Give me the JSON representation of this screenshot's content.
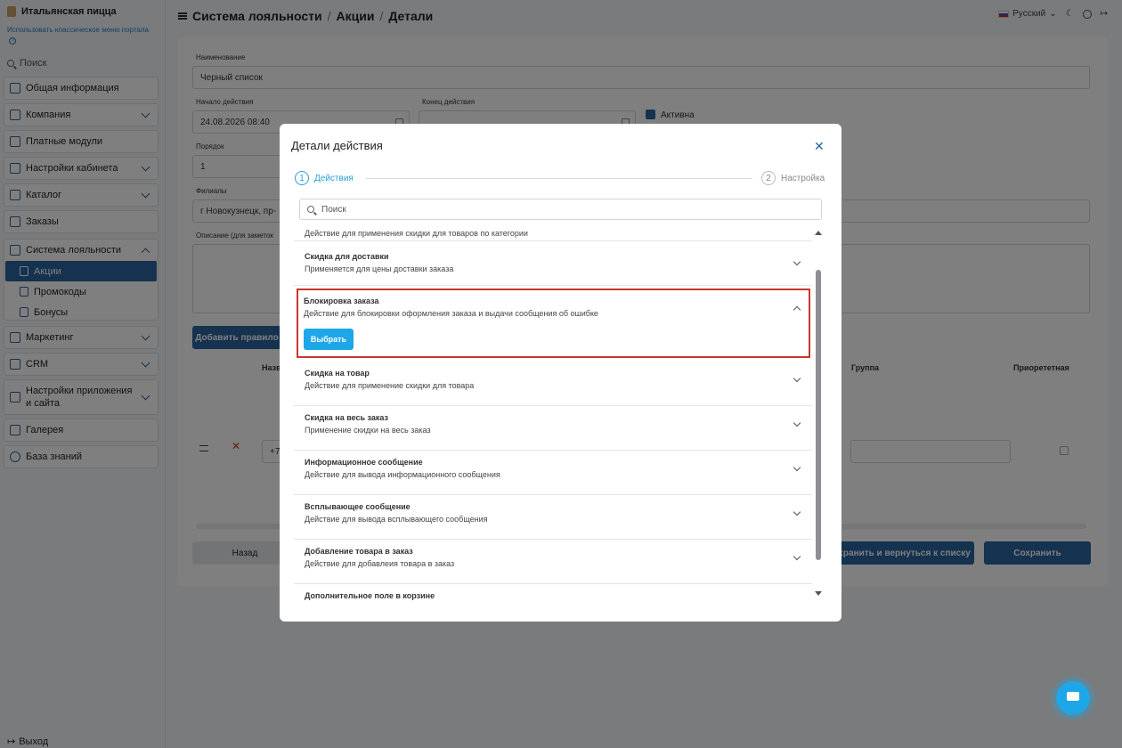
{
  "brand": {
    "name": "Итальянская пицца",
    "classic_link": "Использовать классическое меню портала"
  },
  "sidebar": {
    "search_label": "Поиск",
    "items": [
      {
        "label": "Общая информация"
      },
      {
        "label": "Компания"
      },
      {
        "label": "Платные модули"
      },
      {
        "label": "Настройки кабинета"
      },
      {
        "label": "Каталог"
      },
      {
        "label": "Заказы"
      },
      {
        "label": "Система лояльности"
      },
      {
        "label": "Маркетинг"
      },
      {
        "label": "CRM"
      },
      {
        "label": "Настройки приложения и сайта"
      },
      {
        "label": "Галерея"
      },
      {
        "label": "База знаний"
      }
    ],
    "loyalty_sub": [
      {
        "label": "Акции"
      },
      {
        "label": "Промокоды"
      },
      {
        "label": "Бонусы"
      }
    ],
    "logout": "Выход"
  },
  "header": {
    "crumbs": [
      "Система лояльности",
      "Акции",
      "Детали"
    ],
    "sep": "/",
    "language": "Русский"
  },
  "form": {
    "name_label": "Наименование",
    "name_value": "Черный список",
    "start_label": "Начало действия",
    "start_value": "24.08.2026 08:40",
    "end_label": "Конец действия",
    "active_label": "Активна",
    "order_label": "Порядок",
    "order_value": "1",
    "branches_label": "Филиалы",
    "branches_value": "г Новокузнецк, пр-",
    "desc_label": "Описание (для заметок",
    "add_rule": "Добавить правило",
    "col_name": "Назв",
    "col_group": "Группа",
    "col_priority": "Приорететная",
    "row_value": "+7",
    "back": "Назад",
    "save_return": "Сохранить и вернуться к списку",
    "save": "Сохранить"
  },
  "modal": {
    "title": "Детали действия",
    "steps": [
      {
        "num": "1",
        "label": "Действия"
      },
      {
        "num": "2",
        "label": "Настройка"
      }
    ],
    "search_placeholder": "Поиск",
    "items": [
      {
        "title": "",
        "desc": "Действие для применения скидки для товаров по категории"
      },
      {
        "title": "Скидка для доставки",
        "desc": "Применяется для цены доставки заказа"
      },
      {
        "title": "Блокировка заказа",
        "desc": "Действие для блокировки оформления заказа и выдачи сообщения об ошибке",
        "button": "Выбрать"
      },
      {
        "title": "Скидка на товар",
        "desc": "Действие для применение скидки для товара"
      },
      {
        "title": "Скидка на весь заказ",
        "desc": "Применение скидки на весь заказ"
      },
      {
        "title": "Информационное сообщение",
        "desc": "Действие для вывода информационного сообщения"
      },
      {
        "title": "Всплывающее сообщение",
        "desc": "Действие для вывода всплывающего сообщения"
      },
      {
        "title": "Добавление товара в заказ",
        "desc": "Действие для добавлеия товара в заказ"
      },
      {
        "title": "Дополнительное поле в корзине",
        "desc": ""
      }
    ]
  }
}
